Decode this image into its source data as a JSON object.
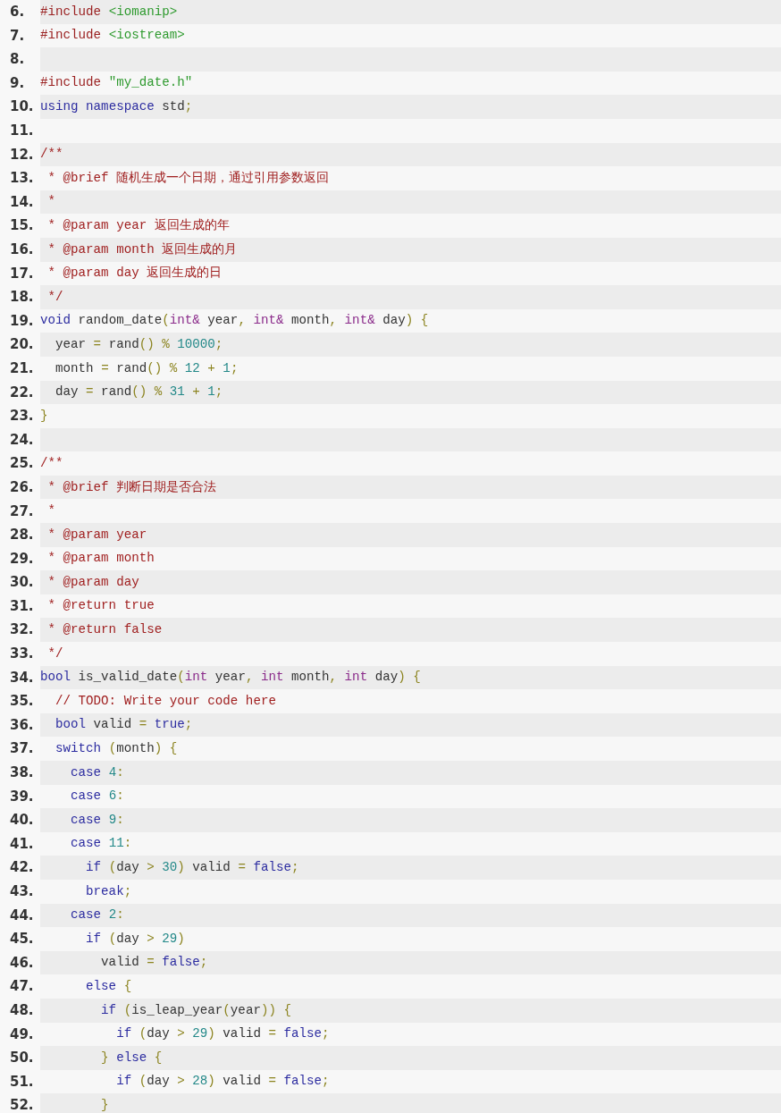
{
  "lines": [
    {
      "number": "6.",
      "tokens": [
        {
          "text": "#include",
          "kind": "pre"
        },
        {
          "text": " <iomanip>",
          "kind": "str"
        }
      ]
    },
    {
      "number": "7.",
      "tokens": [
        {
          "text": "#include",
          "kind": "pre"
        },
        {
          "text": " <iostream>",
          "kind": "str"
        }
      ]
    },
    {
      "number": "8."
    },
    {
      "number": "9.",
      "tokens": [
        {
          "text": "#include",
          "kind": "pre"
        },
        {
          "text": " \"my_date.h\"",
          "kind": "str"
        }
      ]
    },
    {
      "number": "10.",
      "tokens": [
        {
          "text": "using",
          "kind": "kw"
        },
        {
          "text": " namespace",
          "kind": "kw"
        },
        {
          "text": " std",
          "kind": "plain"
        },
        {
          "text": ";",
          "kind": "punc"
        }
      ]
    },
    {
      "number": "11."
    },
    {
      "number": "12.",
      "tokens": [
        {
          "text": "/**",
          "kind": "com"
        }
      ]
    },
    {
      "number": "13.",
      "tokens": [
        {
          "text": " * @brief 随机生成一个日期，通过引用参数返回",
          "kind": "com"
        }
      ]
    },
    {
      "number": "14.",
      "tokens": [
        {
          "text": " *",
          "kind": "com"
        }
      ]
    },
    {
      "number": "15.",
      "tokens": [
        {
          "text": " * @param year 返回生成的年",
          "kind": "com"
        }
      ]
    },
    {
      "number": "16.",
      "tokens": [
        {
          "text": " * @param month 返回生成的月",
          "kind": "com"
        }
      ]
    },
    {
      "number": "17.",
      "tokens": [
        {
          "text": " * @param day 返回生成的日",
          "kind": "com"
        }
      ]
    },
    {
      "number": "18.",
      "tokens": [
        {
          "text": " */",
          "kind": "com"
        }
      ]
    },
    {
      "number": "19.",
      "tokens": [
        {
          "text": "void",
          "kind": "kw"
        },
        {
          "text": " random_date",
          "kind": "plain"
        },
        {
          "text": "(",
          "kind": "punc"
        },
        {
          "text": "int&",
          "kind": "type"
        },
        {
          "text": " year",
          "kind": "plain"
        },
        {
          "text": ",",
          "kind": "punc"
        },
        {
          "text": " int&",
          "kind": "type"
        },
        {
          "text": " month",
          "kind": "plain"
        },
        {
          "text": ",",
          "kind": "punc"
        },
        {
          "text": " int&",
          "kind": "type"
        },
        {
          "text": " day",
          "kind": "plain"
        },
        {
          "text": ")",
          "kind": "punc"
        },
        {
          "text": " {",
          "kind": "punc"
        }
      ]
    },
    {
      "number": "20.",
      "tokens": [
        {
          "text": "  year ",
          "kind": "plain"
        },
        {
          "text": "=",
          "kind": "punc"
        },
        {
          "text": " rand",
          "kind": "plain"
        },
        {
          "text": "()",
          "kind": "punc"
        },
        {
          "text": " %",
          "kind": "punc"
        },
        {
          "text": " 10000",
          "kind": "num"
        },
        {
          "text": ";",
          "kind": "punc"
        }
      ]
    },
    {
      "number": "21.",
      "tokens": [
        {
          "text": "  month ",
          "kind": "plain"
        },
        {
          "text": "=",
          "kind": "punc"
        },
        {
          "text": " rand",
          "kind": "plain"
        },
        {
          "text": "()",
          "kind": "punc"
        },
        {
          "text": " %",
          "kind": "punc"
        },
        {
          "text": " 12",
          "kind": "num"
        },
        {
          "text": " +",
          "kind": "punc"
        },
        {
          "text": " 1",
          "kind": "num"
        },
        {
          "text": ";",
          "kind": "punc"
        }
      ]
    },
    {
      "number": "22.",
      "tokens": [
        {
          "text": "  day ",
          "kind": "plain"
        },
        {
          "text": "=",
          "kind": "punc"
        },
        {
          "text": " rand",
          "kind": "plain"
        },
        {
          "text": "()",
          "kind": "punc"
        },
        {
          "text": " %",
          "kind": "punc"
        },
        {
          "text": " 31",
          "kind": "num"
        },
        {
          "text": " +",
          "kind": "punc"
        },
        {
          "text": " 1",
          "kind": "num"
        },
        {
          "text": ";",
          "kind": "punc"
        }
      ]
    },
    {
      "number": "23.",
      "tokens": [
        {
          "text": "}",
          "kind": "punc"
        }
      ]
    },
    {
      "number": "24."
    },
    {
      "number": "25.",
      "tokens": [
        {
          "text": "/**",
          "kind": "com"
        }
      ]
    },
    {
      "number": "26.",
      "tokens": [
        {
          "text": " * @brief 判断日期是否合法",
          "kind": "com"
        }
      ]
    },
    {
      "number": "27.",
      "tokens": [
        {
          "text": " *",
          "kind": "com"
        }
      ]
    },
    {
      "number": "28.",
      "tokens": [
        {
          "text": " * @param year",
          "kind": "com"
        }
      ]
    },
    {
      "number": "29.",
      "tokens": [
        {
          "text": " * @param month",
          "kind": "com"
        }
      ]
    },
    {
      "number": "30.",
      "tokens": [
        {
          "text": " * @param day",
          "kind": "com"
        }
      ]
    },
    {
      "number": "31.",
      "tokens": [
        {
          "text": " * @return true",
          "kind": "com"
        }
      ]
    },
    {
      "number": "32.",
      "tokens": [
        {
          "text": " * @return false",
          "kind": "com"
        }
      ]
    },
    {
      "number": "33.",
      "tokens": [
        {
          "text": " */",
          "kind": "com"
        }
      ]
    },
    {
      "number": "34.",
      "tokens": [
        {
          "text": "bool",
          "kind": "kw"
        },
        {
          "text": " is_valid_date",
          "kind": "plain"
        },
        {
          "text": "(",
          "kind": "punc"
        },
        {
          "text": "int",
          "kind": "type"
        },
        {
          "text": " year",
          "kind": "plain"
        },
        {
          "text": ",",
          "kind": "punc"
        },
        {
          "text": " int",
          "kind": "type"
        },
        {
          "text": " month",
          "kind": "plain"
        },
        {
          "text": ",",
          "kind": "punc"
        },
        {
          "text": " int",
          "kind": "type"
        },
        {
          "text": " day",
          "kind": "plain"
        },
        {
          "text": ")",
          "kind": "punc"
        },
        {
          "text": " {",
          "kind": "punc"
        }
      ]
    },
    {
      "number": "35.",
      "tokens": [
        {
          "text": "  // TODO: Write your code here",
          "kind": "com"
        }
      ]
    },
    {
      "number": "36.",
      "tokens": [
        {
          "text": "  bool",
          "kind": "kw"
        },
        {
          "text": " valid ",
          "kind": "plain"
        },
        {
          "text": "=",
          "kind": "punc"
        },
        {
          "text": " true",
          "kind": "kw"
        },
        {
          "text": ";",
          "kind": "punc"
        }
      ]
    },
    {
      "number": "37.",
      "tokens": [
        {
          "text": "  switch",
          "kind": "kw"
        },
        {
          "text": " (",
          "kind": "punc"
        },
        {
          "text": "month",
          "kind": "plain"
        },
        {
          "text": ")",
          "kind": "punc"
        },
        {
          "text": " {",
          "kind": "punc"
        }
      ]
    },
    {
      "number": "38.",
      "tokens": [
        {
          "text": "    case",
          "kind": "kw"
        },
        {
          "text": " 4",
          "kind": "num"
        },
        {
          "text": ":",
          "kind": "punc"
        }
      ]
    },
    {
      "number": "39.",
      "tokens": [
        {
          "text": "    case",
          "kind": "kw"
        },
        {
          "text": " 6",
          "kind": "num"
        },
        {
          "text": ":",
          "kind": "punc"
        }
      ]
    },
    {
      "number": "40.",
      "tokens": [
        {
          "text": "    case",
          "kind": "kw"
        },
        {
          "text": " 9",
          "kind": "num"
        },
        {
          "text": ":",
          "kind": "punc"
        }
      ]
    },
    {
      "number": "41.",
      "tokens": [
        {
          "text": "    case",
          "kind": "kw"
        },
        {
          "text": " 11",
          "kind": "num"
        },
        {
          "text": ":",
          "kind": "punc"
        }
      ]
    },
    {
      "number": "42.",
      "tokens": [
        {
          "text": "      if",
          "kind": "kw"
        },
        {
          "text": " (",
          "kind": "punc"
        },
        {
          "text": "day ",
          "kind": "plain"
        },
        {
          "text": ">",
          "kind": "punc"
        },
        {
          "text": " 30",
          "kind": "num"
        },
        {
          "text": ")",
          "kind": "punc"
        },
        {
          "text": " valid ",
          "kind": "plain"
        },
        {
          "text": "=",
          "kind": "punc"
        },
        {
          "text": " false",
          "kind": "kw"
        },
        {
          "text": ";",
          "kind": "punc"
        }
      ]
    },
    {
      "number": "43.",
      "tokens": [
        {
          "text": "      break",
          "kind": "kw"
        },
        {
          "text": ";",
          "kind": "punc"
        }
      ]
    },
    {
      "number": "44.",
      "tokens": [
        {
          "text": "    case",
          "kind": "kw"
        },
        {
          "text": " 2",
          "kind": "num"
        },
        {
          "text": ":",
          "kind": "punc"
        }
      ]
    },
    {
      "number": "45.",
      "tokens": [
        {
          "text": "      if",
          "kind": "kw"
        },
        {
          "text": " (",
          "kind": "punc"
        },
        {
          "text": "day ",
          "kind": "plain"
        },
        {
          "text": ">",
          "kind": "punc"
        },
        {
          "text": " 29",
          "kind": "num"
        },
        {
          "text": ")",
          "kind": "punc"
        }
      ]
    },
    {
      "number": "46.",
      "tokens": [
        {
          "text": "        valid ",
          "kind": "plain"
        },
        {
          "text": "=",
          "kind": "punc"
        },
        {
          "text": " false",
          "kind": "kw"
        },
        {
          "text": ";",
          "kind": "punc"
        }
      ]
    },
    {
      "number": "47.",
      "tokens": [
        {
          "text": "      else",
          "kind": "kw"
        },
        {
          "text": " {",
          "kind": "punc"
        }
      ]
    },
    {
      "number": "48.",
      "tokens": [
        {
          "text": "        if",
          "kind": "kw"
        },
        {
          "text": " (",
          "kind": "punc"
        },
        {
          "text": "is_leap_year",
          "kind": "plain"
        },
        {
          "text": "(",
          "kind": "punc"
        },
        {
          "text": "year",
          "kind": "plain"
        },
        {
          "text": "))",
          "kind": "punc"
        },
        {
          "text": " {",
          "kind": "punc"
        }
      ]
    },
    {
      "number": "49.",
      "tokens": [
        {
          "text": "          if",
          "kind": "kw"
        },
        {
          "text": " (",
          "kind": "punc"
        },
        {
          "text": "day ",
          "kind": "plain"
        },
        {
          "text": ">",
          "kind": "punc"
        },
        {
          "text": " 29",
          "kind": "num"
        },
        {
          "text": ")",
          "kind": "punc"
        },
        {
          "text": " valid ",
          "kind": "plain"
        },
        {
          "text": "=",
          "kind": "punc"
        },
        {
          "text": " false",
          "kind": "kw"
        },
        {
          "text": ";",
          "kind": "punc"
        }
      ]
    },
    {
      "number": "50.",
      "tokens": [
        {
          "text": "        }",
          "kind": "punc"
        },
        {
          "text": " else",
          "kind": "kw"
        },
        {
          "text": " {",
          "kind": "punc"
        }
      ]
    },
    {
      "number": "51.",
      "tokens": [
        {
          "text": "          if",
          "kind": "kw"
        },
        {
          "text": " (",
          "kind": "punc"
        },
        {
          "text": "day ",
          "kind": "plain"
        },
        {
          "text": ">",
          "kind": "punc"
        },
        {
          "text": " 28",
          "kind": "num"
        },
        {
          "text": ")",
          "kind": "punc"
        },
        {
          "text": " valid ",
          "kind": "plain"
        },
        {
          "text": "=",
          "kind": "punc"
        },
        {
          "text": " false",
          "kind": "kw"
        },
        {
          "text": ";",
          "kind": "punc"
        }
      ]
    },
    {
      "number": "52.",
      "tokens": [
        {
          "text": "        }",
          "kind": "punc"
        }
      ]
    }
  ]
}
